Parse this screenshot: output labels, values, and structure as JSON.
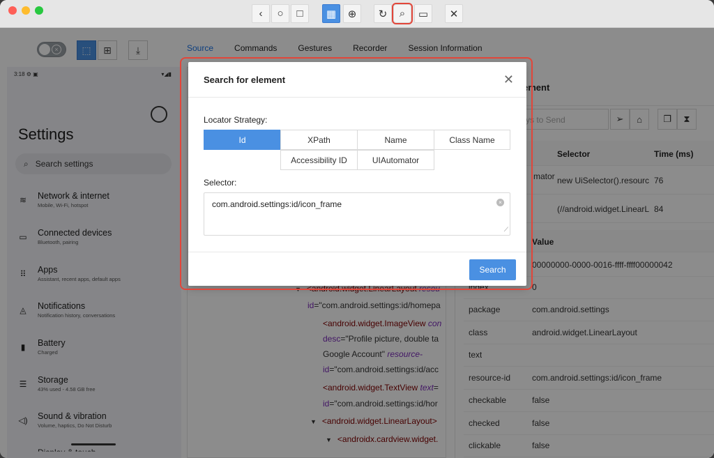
{
  "toolbar": {
    "back_icon": "‹",
    "record_icon": "○",
    "square_icon": "□",
    "grid_icon": "▦",
    "globe_icon": "⊕",
    "refresh_icon": "↻",
    "search_icon": "⌕",
    "video_icon": "▭",
    "close_icon": "✕"
  },
  "tabs": [
    "Source",
    "Commands",
    "Gestures",
    "Recorder",
    "Session Information"
  ],
  "phone": {
    "time": "3:18",
    "status_right": "▾◢▮",
    "title": "Settings",
    "search_placeholder": "Search settings",
    "items": [
      {
        "title": "Network & internet",
        "sub": "Mobile, Wi-Fi, hotspot",
        "icon": "wifi-icon"
      },
      {
        "title": "Connected devices",
        "sub": "Bluetooth, pairing",
        "icon": "devices-icon"
      },
      {
        "title": "Apps",
        "sub": "Assistant, recent apps, default apps",
        "icon": "apps-icon"
      },
      {
        "title": "Notifications",
        "sub": "Notification history, conversations",
        "icon": "bell-icon"
      },
      {
        "title": "Battery",
        "sub": "Charged",
        "icon": "battery-icon"
      },
      {
        "title": "Storage",
        "sub": "43% used - 4.58 GB free",
        "icon": "storage-icon"
      },
      {
        "title": "Sound & vibration",
        "sub": "Volume, haptics, Do Not Disturb",
        "icon": "sound-icon"
      }
    ],
    "cut_item": "Display & touch"
  },
  "source": {
    "l1_tag": "<android.widget.LinearLayout",
    "l1_attr": "resou",
    "l2_attr": "id",
    "l2_val": "=\"com.android.settings:id/homepa",
    "l3_tag": "<android.widget.ImageView",
    "l3_attr": "con",
    "l4_attr": "desc",
    "l4_val": "=\"Profile picture, double ta",
    "l5_val": "Google Account\"",
    "l5_attr": "resource-",
    "l6_attr": "id",
    "l6_val": "=\"com.android.settings:id/acc",
    "l7_tag": "<android.widget.TextView",
    "l7_attr": "text",
    "l7_val": "=",
    "l8_attr": "id",
    "l8_val": "=\"com.android.settings:id/hor",
    "l9_tag": "<android.widget.LinearLayout>",
    "l10_tag": "<androidx.cardview.widget."
  },
  "right": {
    "header": "ement",
    "keys_placeholder": "ys to Send",
    "table_head": {
      "selector": "Selector",
      "time": "Time (ms)"
    },
    "rows": [
      {
        "strategy": "mator",
        "selector": "new UiSelector().resourc",
        "time": "76"
      },
      {
        "strategy": "",
        "selector": "(//android.widget.LinearL",
        "time": "84"
      }
    ],
    "attr_head": {
      "value": "Value"
    },
    "attrs": [
      {
        "name": "",
        "value": "00000000-0000-0016-ffff-ffff00000042"
      },
      {
        "name": "index",
        "value": "0"
      },
      {
        "name": "package",
        "value": "com.android.settings"
      },
      {
        "name": "class",
        "value": "android.widget.LinearLayout"
      },
      {
        "name": "text",
        "value": ""
      },
      {
        "name": "resource-id",
        "value": "com.android.settings:id/icon_frame"
      },
      {
        "name": "checkable",
        "value": "false"
      },
      {
        "name": "checked",
        "value": "false"
      },
      {
        "name": "clickable",
        "value": "false"
      }
    ]
  },
  "modal": {
    "title": "Search for element",
    "close": "✕",
    "strategy_label": "Locator Strategy:",
    "strategies": [
      "Id",
      "XPath",
      "Name",
      "Class Name",
      "Accessibility ID",
      "UIAutomator"
    ],
    "selector_label": "Selector:",
    "selector_value": "com.android.settings:id/icon_frame",
    "search_button": "Search"
  },
  "colors": {
    "accent": "#4a90e2",
    "highlight": "#e2463a"
  }
}
